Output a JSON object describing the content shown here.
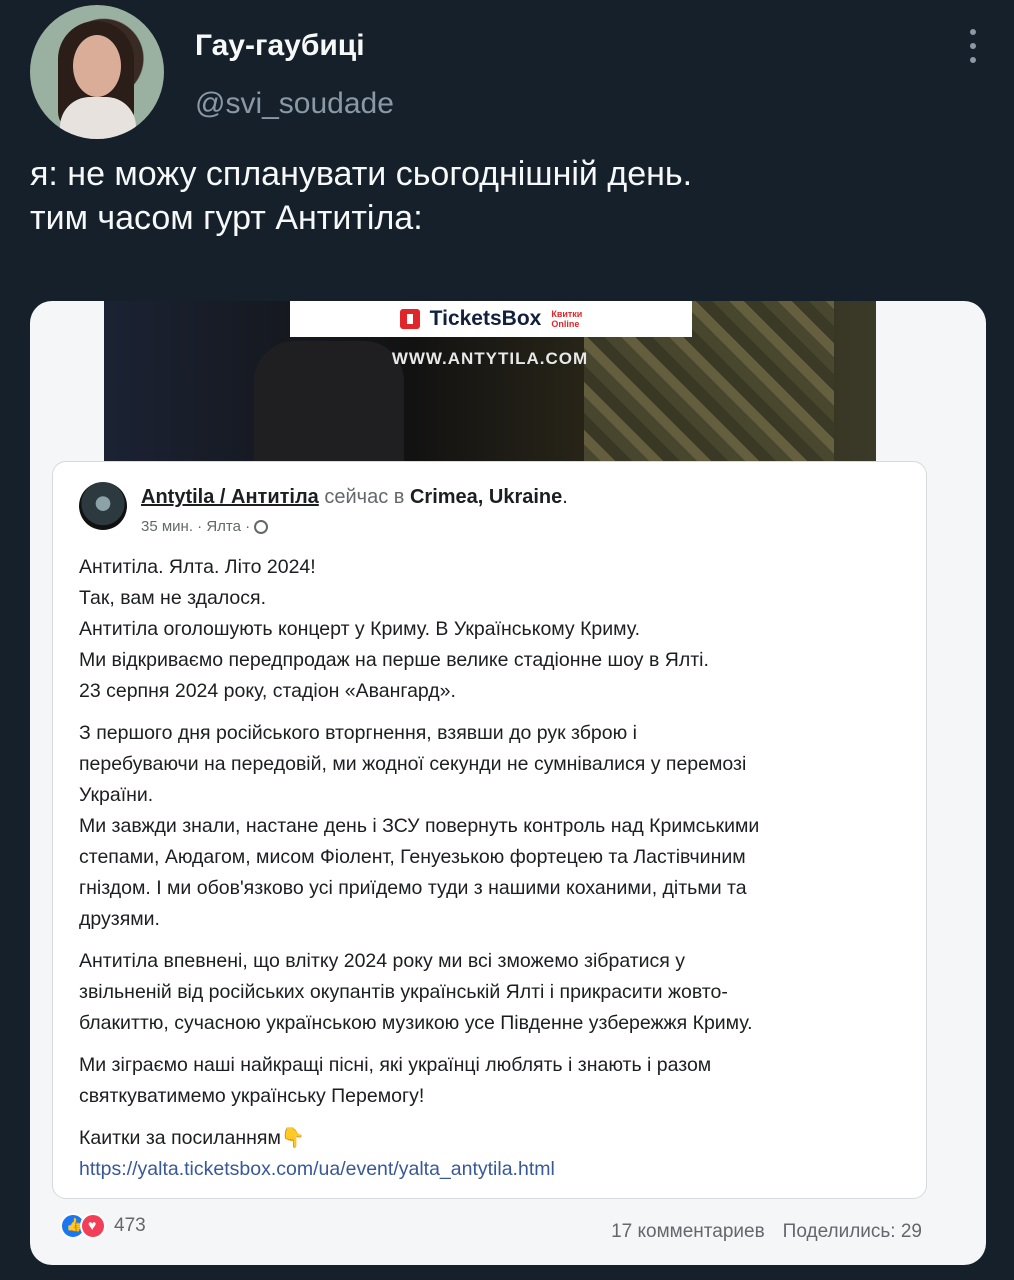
{
  "tweet": {
    "display_name": "Гау-гаубиці",
    "handle": "@svi_soudade",
    "text_lines": [
      "я: не можу спланувати сьогоднішній день.",
      "тим часом гурт Антитіла:"
    ]
  },
  "banner": {
    "ticketsbox_name": "TicketsBox",
    "ticketsbox_sub1": "Квитки",
    "ticketsbox_sub2": "Online",
    "url": "WWW.ANTYTILA.COM"
  },
  "fb_post": {
    "page_name": "Antytila / Антитіла",
    "action": "сейчас в",
    "location": "Crimea, Ukraine",
    "location_suffix": ".",
    "meta": "35 мин. · Ялта ·",
    "paragraphs": [
      [
        "Антитіла. Ялта. Літо 2024!",
        "Так, вам не здалося.",
        "Антитіла оголошують концерт у Криму. В Українському Криму.",
        "Ми відкриваємо передпродаж на перше велике стадіонне шоу в Ялті.",
        "23 серпня 2024 року, стадіон «Авангард»."
      ],
      [
        "З першого дня російського вторгнення, взявши до рук зброю і",
        "перебуваючи на передовій, ми жодної секунди не сумнівалися у перемозі",
        "України.",
        "Ми завжди знали, настане день і ЗСУ повернуть контроль над Кримськими",
        "степами, Аюдагом, мисом Фіолент, Генуезькою фортецею та Ластівчиним",
        "гніздом. І ми обов'язково усі приїдемо туди з нашими коханими, дітьми та",
        "друзями."
      ],
      [
        "Антитіла впевнені, що влітку 2024 року ми всі зможемо зібратися у",
        "звільненій від російських окупантів українській Ялті і прикрасити жовто-",
        "блакиттю, сучасною українською музикою усе Південне узбережжя Криму."
      ],
      [
        "Ми зіграємо наші найкращі пісні, які українці люблять і знають і разом",
        "святкуватимемо українську Перемогу!"
      ]
    ],
    "tickets_label": "Каитки за посиланням👇",
    "tickets_link": "https://yalta.ticketsbox.com/ua/event/yalta_antytila.html",
    "reactions_count": "473",
    "comments": "17 комментариев",
    "shares": "Поделились: 29"
  }
}
